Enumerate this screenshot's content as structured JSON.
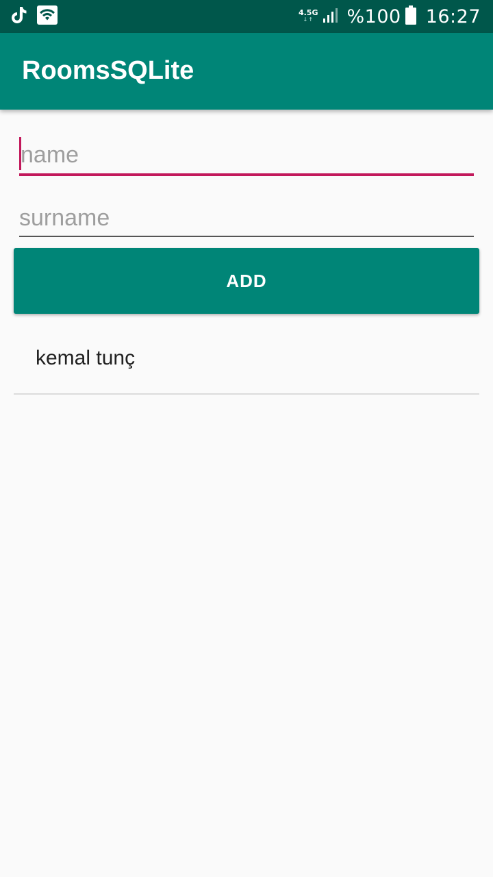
{
  "status_bar": {
    "left_icons": [
      "tiktok-icon",
      "wifi-icon"
    ],
    "network_type": "4.5G",
    "battery_text": "%100",
    "time": "16:27"
  },
  "app_bar": {
    "title": "RoomsSQLite"
  },
  "form": {
    "name": {
      "value": "",
      "placeholder": "name"
    },
    "surname": {
      "value": "",
      "placeholder": "surname"
    },
    "add_label": "ADD"
  },
  "list": {
    "items": [
      {
        "label": "kemal tunç"
      }
    ]
  },
  "colors": {
    "status_bar": "#00574b",
    "primary": "#008577",
    "accent": "#c2185b",
    "background": "#fafafa"
  }
}
